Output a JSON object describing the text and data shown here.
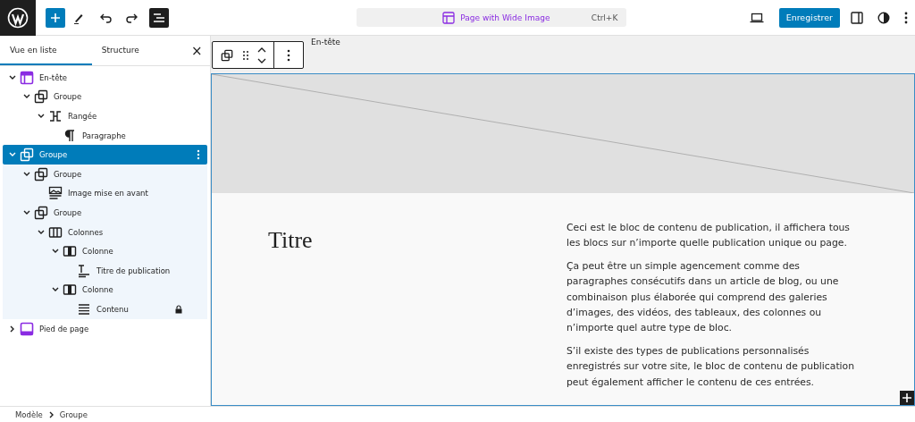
{
  "top_bar": {
    "add_selected": true,
    "document": {
      "title": "Page with Wide Image",
      "shortcut": "Ctrl+K"
    },
    "save_label": "Enregistrer"
  },
  "sidebar": {
    "tabs": [
      {
        "label": "Vue en liste",
        "selected": true
      },
      {
        "label": "Structure",
        "selected": false
      }
    ],
    "close": "×"
  },
  "tree": [
    {
      "label": "En-tête",
      "kind": "template-part",
      "expanded": true,
      "selected": false,
      "children": [
        {
          "label": "Groupe",
          "kind": "group",
          "expanded": true,
          "selected": false,
          "children": [
            {
              "label": "Rangée",
              "kind": "row",
              "expanded": true,
              "selected": false,
              "children": [
                {
                  "label": "Paragraphe",
                  "kind": "paragraph",
                  "selected": false
                }
              ]
            }
          ]
        }
      ]
    },
    {
      "label": "Groupe",
      "kind": "group",
      "expanded": true,
      "selected": true,
      "children": [
        {
          "label": "Groupe",
          "kind": "group",
          "expanded": true,
          "selected": false,
          "children": [
            {
              "label": "Image mise en avant",
              "kind": "image",
              "selected": false
            }
          ]
        },
        {
          "label": "Groupe",
          "kind": "group",
          "expanded": true,
          "selected": false,
          "children": [
            {
              "label": "Colonnes",
              "kind": "columns",
              "expanded": true,
              "selected": false,
              "children": [
                {
                  "label": "Colonne",
                  "kind": "column",
                  "expanded": true,
                  "selected": false,
                  "children": [
                    {
                      "label": "Titre de publication",
                      "kind": "title",
                      "selected": false
                    }
                  ]
                },
                {
                  "label": "Colonne",
                  "kind": "column",
                  "expanded": true,
                  "selected": false,
                  "children": [
                    {
                      "label": "Contenu",
                      "kind": "content",
                      "selected": false,
                      "locked": true
                    }
                  ]
                }
              ]
            }
          ]
        }
      ]
    },
    {
      "label": "Pied de page",
      "kind": "template-part-footer",
      "expanded": false,
      "selected": false
    }
  ],
  "canvas": {
    "header_label": "En-tête",
    "title": "Titre",
    "paragraphs": [
      "Ceci est le bloc de contenu de publication, il affichera tous les blocs sur n’importe quelle publication unique ou page.",
      "Ça peut être un simple agencement comme des paragraphes consécutifs dans un article de blog, ou une combinaison plus élaborée qui comprend des galeries d’images, des vidéos, des tableaux, des colonnes ou n’importe quel autre type de bloc.",
      "S’il existe des types de publications personnalisés enregistrés sur votre site, le bloc de contenu de publication peut également afficher le contenu de ces entrées."
    ]
  },
  "breadcrumb": [
    "Modèle",
    "Groupe"
  ]
}
